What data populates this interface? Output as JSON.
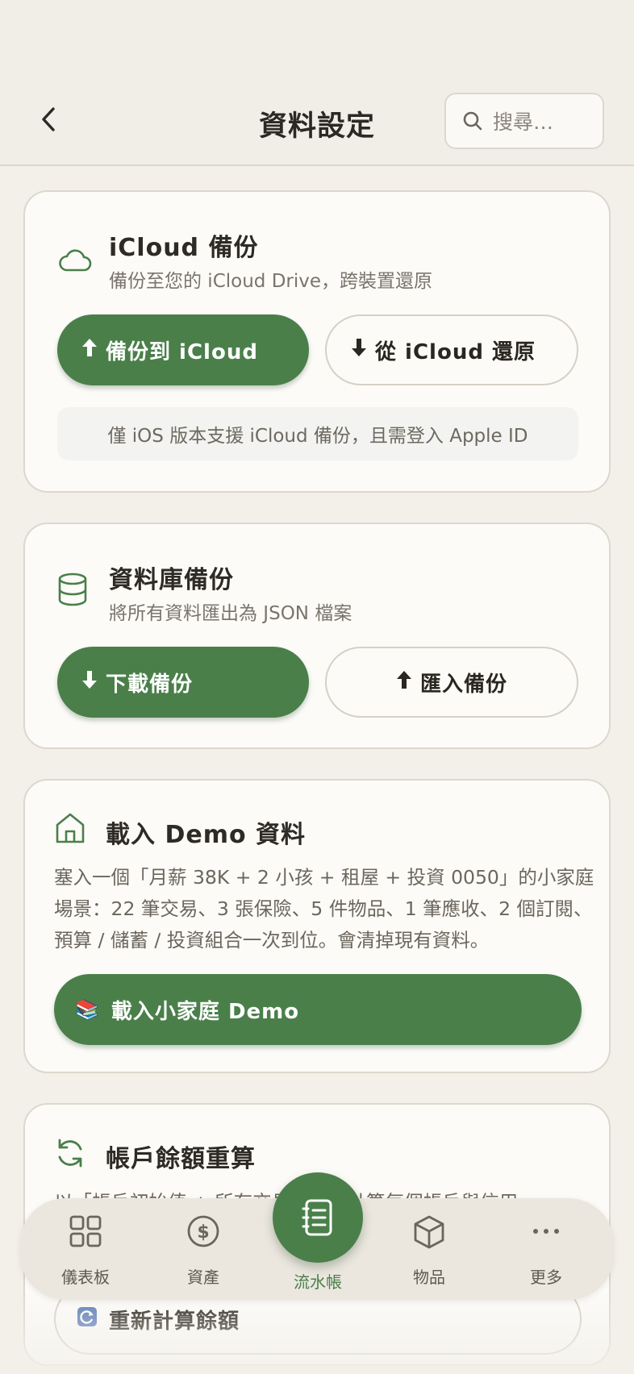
{
  "header": {
    "title": "資料設定",
    "search_placeholder": "搜尋…"
  },
  "icloud": {
    "title": "iCloud 備份",
    "subtitle": "備份至您的 iCloud Drive，跨裝置還原",
    "backup_label": "備份到 iCloud",
    "restore_label": "從 iCloud 還原",
    "note": "僅 iOS 版本支援 iCloud 備份，且需登入 Apple ID"
  },
  "database": {
    "title": "資料庫備份",
    "subtitle": "將所有資料匯出為 JSON 檔案",
    "download_label": "下載備份",
    "import_label": "匯入備份"
  },
  "demo": {
    "title": "載入 Demo 資料",
    "description": "塞入一個「月薪 38K + 2 小孩 + 租屋 + 投資 0050」的小家庭場景：22 筆交易、3 張保險、5 件物品、1 筆應收、2 個訂閱、預算 / 儲蓄 / 投資組合一次到位。會清掉現有資料。",
    "button_icon": "📚",
    "button_label": "載入小家庭 Demo"
  },
  "recalc": {
    "title": "帳戶餘額重算",
    "description": "以「帳戶初始值 + 所有交易」重新計算每個帳戶與信用",
    "button_label": "重新計算餘額"
  },
  "nav": {
    "items": [
      {
        "label": "儀表板",
        "icon": "grid-icon"
      },
      {
        "label": "資產",
        "icon": "dollar-icon"
      },
      {
        "label": "流水帳",
        "icon": "ledger-icon"
      },
      {
        "label": "物品",
        "icon": "box-icon"
      },
      {
        "label": "更多",
        "icon": "more-icon"
      }
    ]
  },
  "colors": {
    "primary": "#4a7f4a",
    "background": "#f3f0ea",
    "card": "#fcfbf8"
  }
}
